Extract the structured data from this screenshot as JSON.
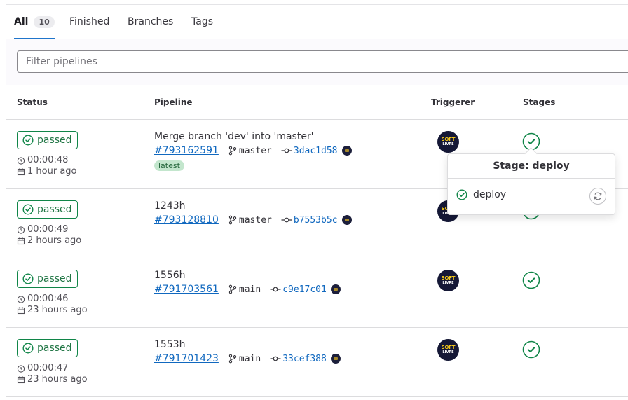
{
  "tabs": [
    {
      "label": "All",
      "count": "10",
      "active": true
    },
    {
      "label": "Finished"
    },
    {
      "label": "Branches"
    },
    {
      "label": "Tags"
    }
  ],
  "filter": {
    "placeholder": "Filter pipelines"
  },
  "columns": {
    "status": "Status",
    "pipeline": "Pipeline",
    "triggerer": "Triggerer",
    "stages": "Stages"
  },
  "avatar": {
    "line1": "SOFT",
    "line2": "LIVRE"
  },
  "rows": [
    {
      "status": "passed",
      "duration": "00:00:48",
      "time_ago": "1 hour ago",
      "title": "Merge branch 'dev' into 'master'",
      "id": "#793162591",
      "ref": "master",
      "sha": "3dac1d58",
      "badge": "latest"
    },
    {
      "status": "passed",
      "duration": "00:00:49",
      "time_ago": "2 hours ago",
      "title": "1243h",
      "id": "#793128810",
      "ref": "master",
      "sha": "b7553b5c"
    },
    {
      "status": "passed",
      "duration": "00:00:46",
      "time_ago": "23 hours ago",
      "title": "1556h",
      "id": "#791703561",
      "ref": "main",
      "sha": "c9e17c01"
    },
    {
      "status": "passed",
      "duration": "00:00:47",
      "time_ago": "23 hours ago",
      "title": "1553h",
      "id": "#791701423",
      "ref": "main",
      "sha": "33cef388"
    }
  ],
  "popover": {
    "title": "Stage: deploy",
    "job": "deploy"
  },
  "colors": {
    "success": "#108548",
    "link": "#1068bf",
    "accent": "#1f75cb"
  }
}
